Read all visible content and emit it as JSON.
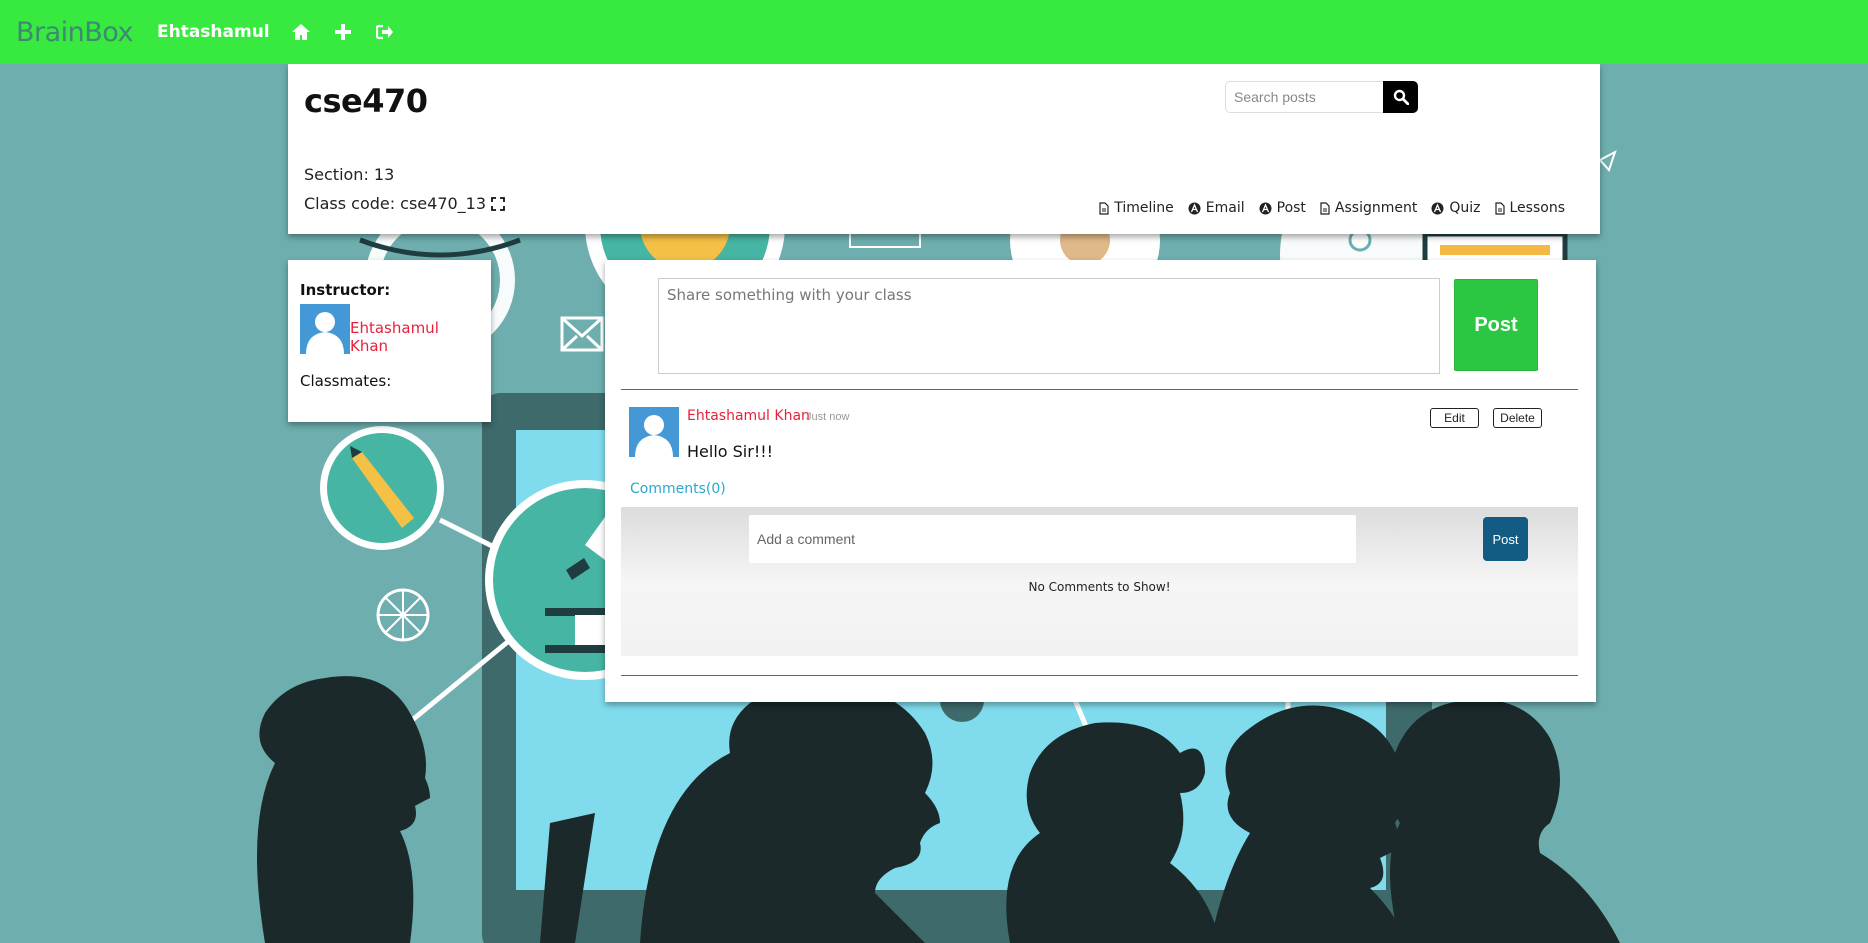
{
  "navbar": {
    "brand": "BrainBox",
    "user": "Ehtashamul",
    "icons": [
      "home-icon",
      "plus-icon",
      "sign-out-icon"
    ],
    "background_color": "#38ea3f"
  },
  "header": {
    "class_title": "cse470",
    "section": "Section: 13",
    "class_code_label": "Class code:",
    "class_code": "cse470_13",
    "search": {
      "placeholder": "Search posts"
    },
    "tabs": [
      {
        "label": "Timeline",
        "icon": "file-icon"
      },
      {
        "label": "Email",
        "icon": "circle-a-icon"
      },
      {
        "label": "Post",
        "icon": "circle-a-icon"
      },
      {
        "label": "Assignment",
        "icon": "file-icon"
      },
      {
        "label": "Quiz",
        "icon": "circle-a-icon"
      },
      {
        "label": "Lessons",
        "icon": "file-icon"
      }
    ]
  },
  "sidebar": {
    "instructor_label": "Instructor:",
    "instructor_name": "Ehtashamul Khan",
    "classmates_label": "Classmates:"
  },
  "feed": {
    "share_placeholder": "Share something with your class",
    "post_button": "Post",
    "posts": [
      {
        "author": "Ehtashamul Khan",
        "time": "Just now",
        "body": "Hello Sir!!!",
        "edit_label": "Edit",
        "delete_label": "Delete",
        "comments_link": "Comments(0)",
        "comment_placeholder": "Add a comment",
        "comment_post_label": "Post",
        "no_comments": "No Comments to Show!"
      }
    ]
  },
  "colors": {
    "accent_green": "#2cc742",
    "author_red": "#e8203b",
    "link_blue": "#2aa7d0",
    "comment_button": "#125b82",
    "avatar_blue": "#4498d5"
  }
}
